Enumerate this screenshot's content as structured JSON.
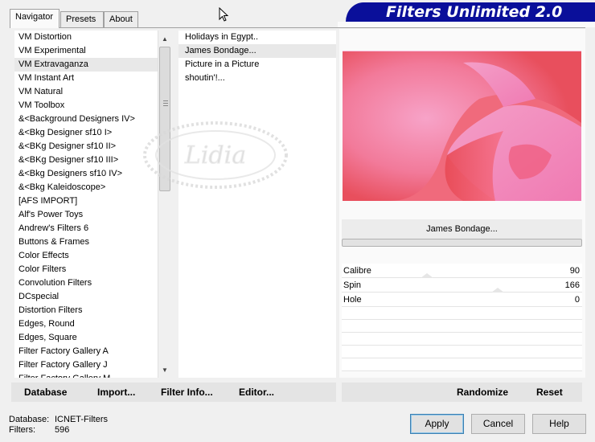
{
  "tabs": [
    {
      "label": "Navigator"
    },
    {
      "label": "Presets"
    },
    {
      "label": "About"
    }
  ],
  "banner": {
    "title": "Filters Unlimited 2.0"
  },
  "categories": [
    "VM Distortion",
    "VM Experimental",
    "VM Extravaganza",
    "VM Instant Art",
    "VM Natural",
    "VM Toolbox",
    "&<Background Designers IV>",
    "&<Bkg Designer sf10 I>",
    "&<BKg Designer sf10 II>",
    "&<BKg Designer sf10 III>",
    "&<Bkg Designers sf10 IV>",
    "&<Bkg Kaleidoscope>",
    "[AFS IMPORT]",
    "Alf's Power Toys",
    "Andrew's Filters 6",
    "Buttons & Frames",
    "Color Effects",
    "Color Filters",
    "Convolution Filters",
    "DCspecial",
    "Distortion Filters",
    "Edges, Round",
    "Edges, Square",
    "Filter Factory Gallery A",
    "Filter Factory Gallery J",
    "Filter Factory Gallery M"
  ],
  "selected_category": "VM Extravaganza",
  "filters": [
    "Holidays in Egypt..",
    "James Bondage...",
    "Picture in a Picture",
    "shoutin'!..."
  ],
  "selected_filter": "James Bondage...",
  "current_filter_name": "James Bondage...",
  "params": [
    {
      "label": "Calibre",
      "value": "90"
    },
    {
      "label": "Spin",
      "value": "166"
    },
    {
      "label": "Hole",
      "value": "0"
    }
  ],
  "toolbar_left": {
    "database": "Database",
    "import": "Import...",
    "filter_info": "Filter Info...",
    "editor": "Editor..."
  },
  "toolbar_right": {
    "randomize": "Randomize",
    "reset": "Reset"
  },
  "status": {
    "database_label": "Database:",
    "database_value": "ICNET-Filters",
    "filters_label": "Filters:",
    "filters_value": "596"
  },
  "buttons": {
    "apply": "Apply",
    "cancel": "Cancel",
    "help": "Help"
  },
  "watermark": {
    "text": "Lidia"
  },
  "colors": {
    "banner_bg": "#0a0f9a",
    "preview_main": "#f06a7c",
    "preview_light": "#f595c4"
  }
}
